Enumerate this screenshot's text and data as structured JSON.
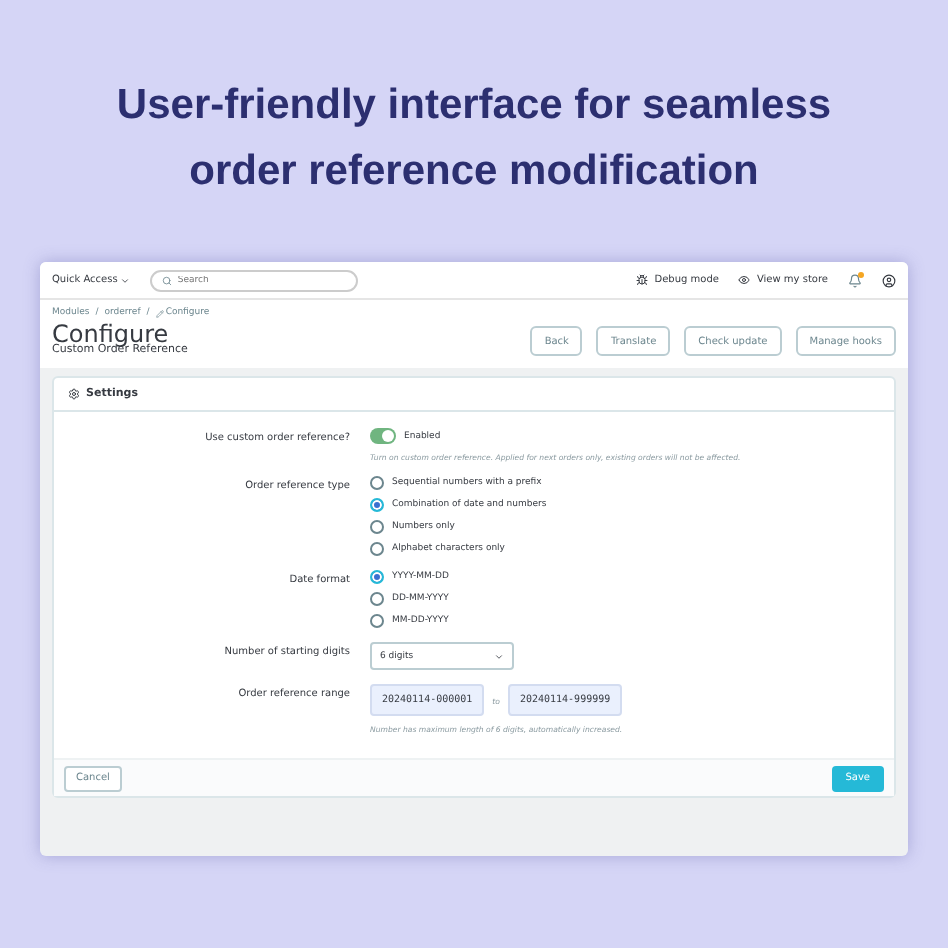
{
  "headline": "User-friendly interface for seamless order reference modification",
  "topbar": {
    "quick_access": "Quick Access",
    "search": {
      "placeholder": "Search"
    },
    "debug_mode": "Debug mode",
    "view_store": "View my store",
    "notifications": true
  },
  "breadcrumb": [
    "Modules",
    "orderref",
    "Configure"
  ],
  "breadcrumb_separator": "/",
  "page_title": "Configure",
  "page_subtitle": "Custom Order Reference",
  "header_buttons": [
    "Back",
    "Translate",
    "Check update",
    "Manage hooks"
  ],
  "panel": {
    "title": "Settings",
    "fields": [
      {
        "kind": "switch",
        "label": "Use custom order reference?",
        "on": true,
        "value": "Enabled",
        "help": "Turn on custom order reference. Applied for next orders only, existing orders will not be affected."
      },
      {
        "kind": "radio",
        "label": "Order reference type",
        "options": [
          {
            "label": "Sequential numbers with a prefix",
            "selected": false
          },
          {
            "label": "Combination of date and numbers",
            "selected": true
          },
          {
            "label": "Numbers only",
            "selected": false
          },
          {
            "label": "Alphabet characters only",
            "selected": false
          }
        ]
      },
      {
        "kind": "radio",
        "label": "Date format",
        "options": [
          {
            "label": "YYYY-MM-DD",
            "selected": true
          },
          {
            "label": "DD-MM-YYYY",
            "selected": false
          },
          {
            "label": "MM-DD-YYYY",
            "selected": false
          }
        ]
      },
      {
        "kind": "select",
        "label": "Number of starting digits",
        "value": "6 digits"
      },
      {
        "kind": "range",
        "label": "Order reference range",
        "from": "20240114-000001",
        "separator": "to",
        "to": "20240114-999999",
        "help": "Number has maximum length of 6 digits, automatically increased."
      }
    ],
    "cancel": "Cancel",
    "save": "Save"
  }
}
